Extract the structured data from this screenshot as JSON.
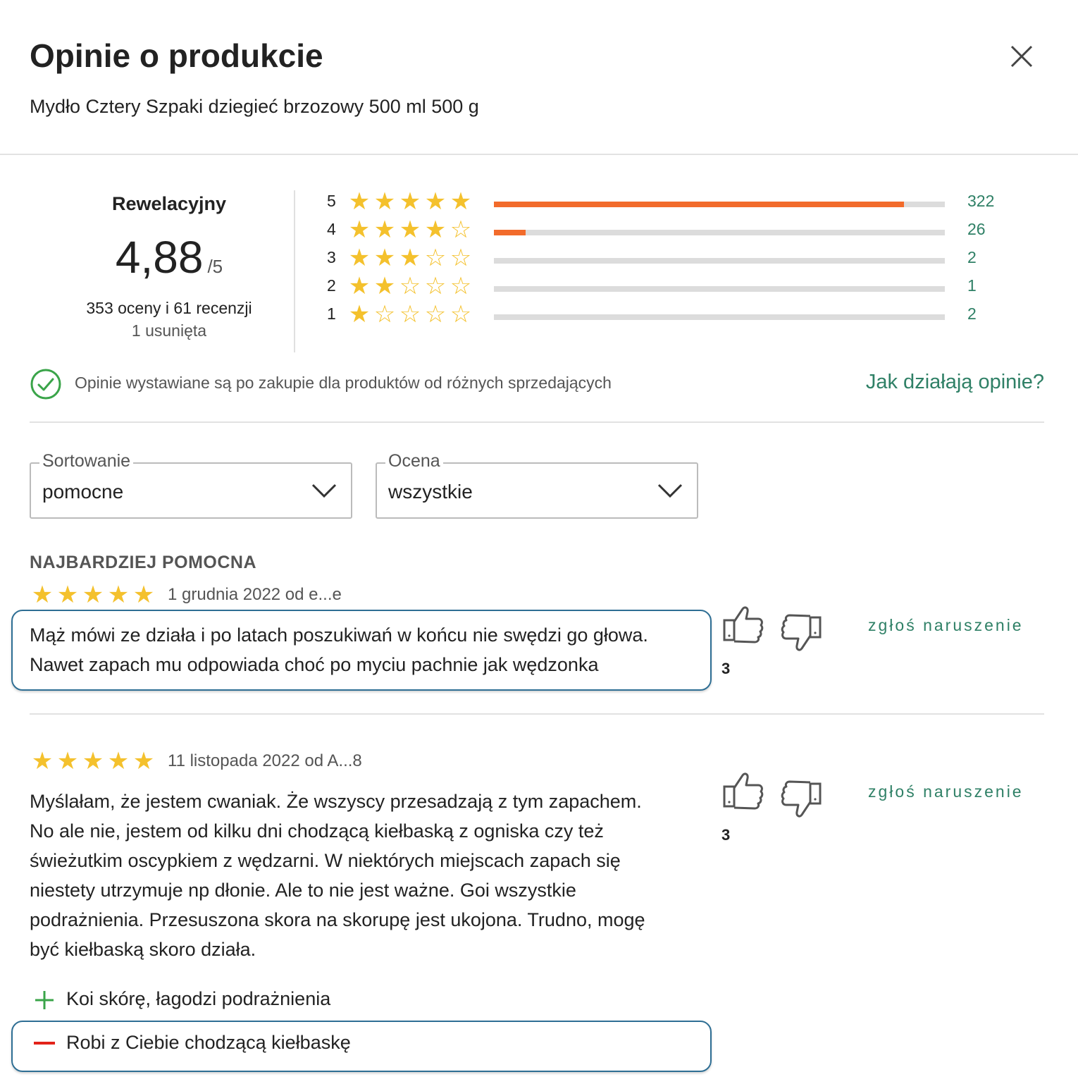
{
  "header": {
    "title": "Opinie o produkcie",
    "product_name": "Mydło Cztery Szpaki dziegieć brzozowy 500 ml 500 g"
  },
  "summary": {
    "verdict": "Rewelacyjny",
    "score": "4,88",
    "score_max": "/5",
    "counts": "353 oceny i 61 recenzji",
    "removed": "1 usunięta"
  },
  "distribution": [
    {
      "level": "5",
      "stars": 5,
      "count": "322",
      "fraction": 0.91
    },
    {
      "level": "4",
      "stars": 4,
      "count": "26",
      "fraction": 0.07
    },
    {
      "level": "3",
      "stars": 3,
      "count": "2",
      "fraction": 0.0
    },
    {
      "level": "2",
      "stars": 2,
      "count": "1",
      "fraction": 0.0
    },
    {
      "level": "1",
      "stars": 1,
      "count": "2",
      "fraction": 0.0
    }
  ],
  "verified": {
    "text": "Opinie wystawiane są po zakupie dla produktów od różnych sprzedających",
    "link": "Jak działają opinie?"
  },
  "filters": {
    "sort_label": "Sortowanie",
    "sort_value": "pomocne",
    "rating_label": "Ocena",
    "rating_value": "wszystkie"
  },
  "section_label": "NAJBARDZIEJ POMOCNA",
  "reviews": [
    {
      "stars": 5,
      "meta": "1 grudnia 2022 od e...e",
      "text_lines": [
        "Mąż mówi ze działa i po latach poszukiwań w końcu nie swędzi go głowa.",
        "Nawet zapach mu odpowiada choć po myciu pachnie jak wędzonka"
      ],
      "likes": "3",
      "report": "zgłoś naruszenie"
    },
    {
      "stars": 5,
      "meta": "11 listopada 2022 od A...8",
      "text_lines": [
        "Myślałam, że jestem cwaniak. Że wszyscy przesadzają z tym zapachem.",
        "No ale nie, jestem od kilku dni chodzącą kiełbaską z ogniska czy też",
        "świeżutkim oscypkiem z wędzarni. W niektórych miejscach zapach się",
        "niestety utrzymuje np dłonie. Ale to nie jest ważne. Goi wszystkie",
        "podrażnienia. Przesuszona skora na skorupę jest ukojona. Trudno, mogę",
        "być kiełbaską skoro działa."
      ],
      "likes": "3",
      "report": "zgłoś naruszenie",
      "pro": "Koi skórę, łagodzi podrażnienia",
      "con": "Robi z Ciebie chodzącą kiełbaskę"
    }
  ],
  "colors": {
    "accent_green": "#2f8066",
    "bar_orange": "#f26b2b",
    "star_yellow": "#f4c12d",
    "check_green": "#3aa449",
    "minus_red": "#e2231a"
  },
  "icons": [
    "close-icon",
    "star-icon",
    "checkmark-circle-icon",
    "chevron-down-icon",
    "thumbs-up-icon",
    "thumbs-down-icon",
    "plus-icon",
    "minus-icon"
  ]
}
